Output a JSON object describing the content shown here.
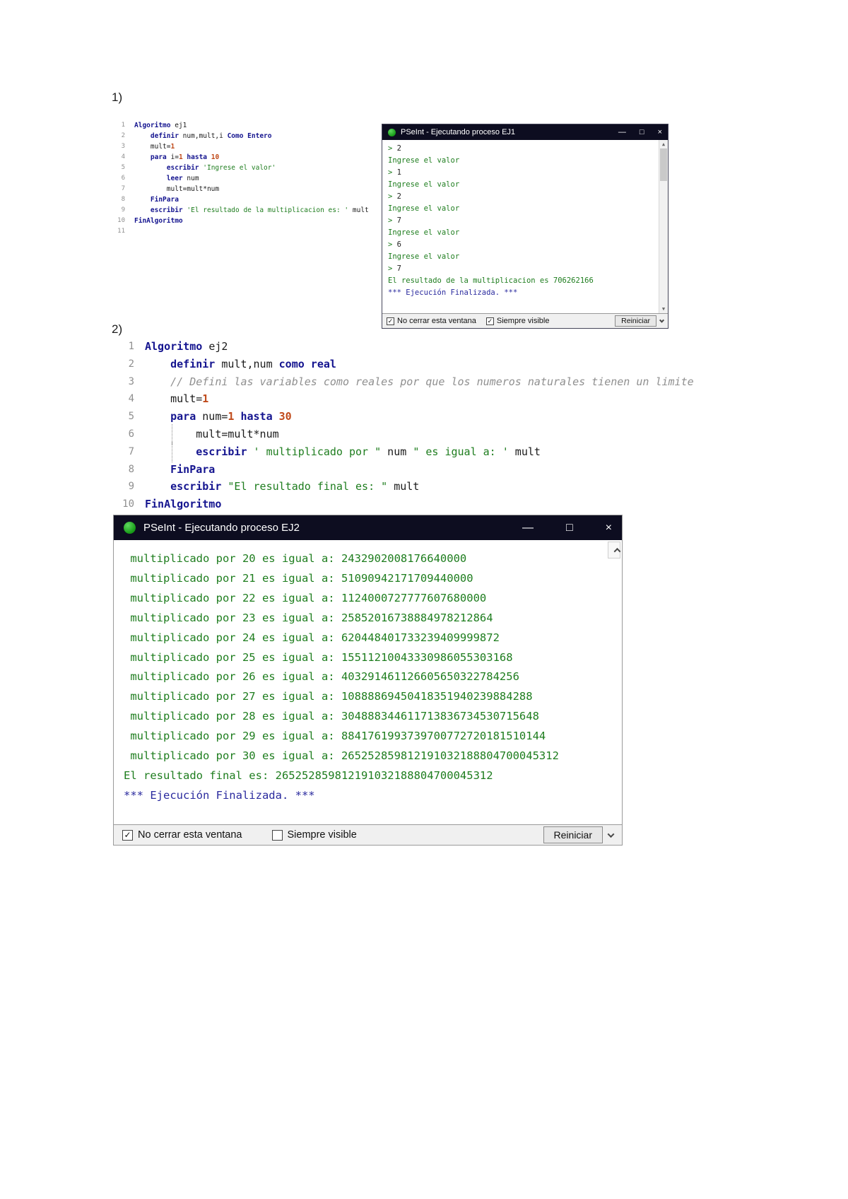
{
  "page": {
    "section1_label": "1)",
    "section2_label": "2)"
  },
  "colors": {
    "title_bar": "#0d0d20",
    "keyword_blue": "#14148f",
    "number_orange": "#c04a1a",
    "string_green": "#1e7d1e",
    "comment_gray": "#8f8f8f",
    "console_green": "#1e7d1e",
    "console_blue": "#2a2a9e",
    "icon_green": "#169a16"
  },
  "editor1": {
    "lines": [
      {
        "n": "1",
        "seg": [
          [
            "Algoritmo ",
            "kw"
          ],
          [
            "ej1",
            "pl"
          ]
        ]
      },
      {
        "n": "2",
        "seg": [
          [
            "    ",
            "pl"
          ],
          [
            "definir ",
            "kw"
          ],
          [
            "num,mult,i ",
            "pl"
          ],
          [
            "Como Entero",
            "kw"
          ]
        ]
      },
      {
        "n": "3",
        "seg": [
          [
            "    mult=",
            "pl"
          ],
          [
            "1",
            "num"
          ]
        ]
      },
      {
        "n": "4",
        "seg": [
          [
            "    ",
            "pl"
          ],
          [
            "para ",
            "kw"
          ],
          [
            "i=",
            "pl"
          ],
          [
            "1",
            "num"
          ],
          [
            " ",
            "pl"
          ],
          [
            "hasta ",
            "kw"
          ],
          [
            "10",
            "num"
          ]
        ]
      },
      {
        "n": "5",
        "seg": [
          [
            "        ",
            "pl"
          ],
          [
            "escribir ",
            "kw"
          ],
          [
            "'Ingrese el valor'",
            "str"
          ]
        ]
      },
      {
        "n": "6",
        "seg": [
          [
            "        ",
            "pl"
          ],
          [
            "leer ",
            "kw"
          ],
          [
            "num",
            "pl"
          ]
        ]
      },
      {
        "n": "7",
        "seg": [
          [
            "        mult=mult*num",
            "pl"
          ]
        ]
      },
      {
        "n": "8",
        "seg": [
          [
            "    ",
            "pl"
          ],
          [
            "FinPara",
            "kw"
          ]
        ]
      },
      {
        "n": "9",
        "seg": [
          [
            "    ",
            "pl"
          ],
          [
            "escribir ",
            "kw"
          ],
          [
            "'El resultado de la multiplicacion es: '",
            "str"
          ],
          [
            " mult",
            "pl"
          ]
        ]
      },
      {
        "n": "10",
        "seg": [
          [
            "FinAlgoritmo",
            "kw"
          ]
        ]
      },
      {
        "n": "11",
        "seg": []
      }
    ]
  },
  "console1": {
    "title": "PSeInt - Ejecutando proceso EJ1",
    "controls": {
      "minimize": "—",
      "maximize": "□",
      "close": "×"
    },
    "lines": [
      {
        "seg": [
          [
            "> ",
            "g"
          ],
          [
            "2",
            "k"
          ]
        ]
      },
      {
        "seg": [
          [
            "Ingrese el valor",
            "g"
          ]
        ]
      },
      {
        "seg": [
          [
            "> ",
            "g"
          ],
          [
            "1",
            "k"
          ]
        ]
      },
      {
        "seg": [
          [
            "Ingrese el valor",
            "g"
          ]
        ]
      },
      {
        "seg": [
          [
            "> ",
            "g"
          ],
          [
            "2",
            "k"
          ]
        ]
      },
      {
        "seg": [
          [
            "Ingrese el valor",
            "g"
          ]
        ]
      },
      {
        "seg": [
          [
            "> ",
            "g"
          ],
          [
            "7",
            "k"
          ]
        ]
      },
      {
        "seg": [
          [
            "Ingrese el valor",
            "g"
          ]
        ]
      },
      {
        "seg": [
          [
            "> ",
            "g"
          ],
          [
            "6",
            "k"
          ]
        ]
      },
      {
        "seg": [
          [
            "Ingrese el valor",
            "g"
          ]
        ]
      },
      {
        "seg": [
          [
            "> ",
            "g"
          ],
          [
            "7",
            "k"
          ]
        ]
      },
      {
        "seg": [
          [
            "El resultado de la multiplicacion es 706262166",
            "g"
          ]
        ]
      },
      {
        "seg": [
          [
            "*** Ejecución Finalizada. ***",
            "b"
          ]
        ]
      }
    ],
    "footer": {
      "no_close_label": "No cerrar esta ventana",
      "no_close_checked": true,
      "always_visible_label": "Siempre visible",
      "always_visible_checked": true,
      "restart_label": "Reiniciar",
      "check_icon": "✓"
    }
  },
  "editor2": {
    "lines": [
      {
        "n": "1",
        "seg": [
          [
            "Algoritmo ",
            "kw"
          ],
          [
            "ej2",
            "pl"
          ]
        ]
      },
      {
        "n": "2",
        "seg": [
          [
            "    ",
            "pl"
          ],
          [
            "definir ",
            "kw"
          ],
          [
            "mult,num ",
            "pl"
          ],
          [
            "como real",
            "kw"
          ]
        ]
      },
      {
        "n": "3",
        "seg": [
          [
            "    ",
            "pl"
          ],
          [
            "// Defini las variables como reales por que los numeros naturales tienen un limite",
            "cmt"
          ]
        ]
      },
      {
        "n": "4",
        "seg": [
          [
            "    mult=",
            "pl"
          ],
          [
            "1",
            "num"
          ]
        ]
      },
      {
        "n": "5",
        "seg": [
          [
            "    ",
            "pl"
          ],
          [
            "para ",
            "kw"
          ],
          [
            "num=",
            "pl"
          ],
          [
            "1",
            "num"
          ],
          [
            " ",
            "pl"
          ],
          [
            "hasta ",
            "kw"
          ],
          [
            "30",
            "num"
          ]
        ]
      },
      {
        "n": "6",
        "guide": true,
        "seg": [
          [
            "        mult=mult*num",
            "pl"
          ]
        ]
      },
      {
        "n": "7",
        "guide": true,
        "seg": [
          [
            "        ",
            "pl"
          ],
          [
            "escribir ",
            "kw"
          ],
          [
            "' multiplicado por \"",
            "str"
          ],
          [
            " num ",
            "pl"
          ],
          [
            "\" es igual a: '",
            "str"
          ],
          [
            " mult",
            "pl"
          ]
        ]
      },
      {
        "n": "8",
        "seg": [
          [
            "    ",
            "pl"
          ],
          [
            "FinPara",
            "kw"
          ]
        ]
      },
      {
        "n": "9",
        "seg": [
          [
            "    ",
            "pl"
          ],
          [
            "escribir ",
            "kw"
          ],
          [
            "\"El resultado final es: \"",
            "str"
          ],
          [
            " mult",
            "pl"
          ]
        ]
      },
      {
        "n": "10",
        "seg": [
          [
            "FinAlgoritmo",
            "kw"
          ]
        ]
      }
    ]
  },
  "console2": {
    "title": "PSeInt - Ejecutando proceso EJ2",
    "controls": {
      "minimize": "—",
      "maximize": "□",
      "close": "×"
    },
    "lines": [
      {
        "seg": [
          [
            " multiplicado por 20 es igual a: 2432902008176640000",
            "g"
          ]
        ]
      },
      {
        "seg": [
          [
            " multiplicado por 21 es igual a: 51090942171709440000",
            "g"
          ]
        ]
      },
      {
        "seg": [
          [
            " multiplicado por 22 es igual a: 1124000727777607680000",
            "g"
          ]
        ]
      },
      {
        "seg": [
          [
            " multiplicado por 23 es igual a: 25852016738884978212864",
            "g"
          ]
        ]
      },
      {
        "seg": [
          [
            " multiplicado por 24 es igual a: 620448401733239409999872",
            "g"
          ]
        ]
      },
      {
        "seg": [
          [
            " multiplicado por 25 es igual a: 15511210043330986055303168",
            "g"
          ]
        ]
      },
      {
        "seg": [
          [
            " multiplicado por 26 es igual a: 403291461126605650322784256",
            "g"
          ]
        ]
      },
      {
        "seg": [
          [
            " multiplicado por 27 es igual a: 10888869450418351940239884288",
            "g"
          ]
        ]
      },
      {
        "seg": [
          [
            " multiplicado por 28 es igual a: 304888344611713836734530715648",
            "g"
          ]
        ]
      },
      {
        "seg": [
          [
            " multiplicado por 29 es igual a: 8841761993739700772720181510144",
            "g"
          ]
        ]
      },
      {
        "seg": [
          [
            " multiplicado por 30 es igual a: 265252859812191032188804700045312",
            "g"
          ]
        ]
      },
      {
        "seg": [
          [
            "El resultado final es: 265252859812191032188804700045312",
            "g"
          ]
        ]
      },
      {
        "seg": [
          [
            "*** Ejecución Finalizada. ***",
            "b"
          ]
        ]
      }
    ],
    "footer": {
      "no_close_label": "No cerrar esta ventana",
      "no_close_checked": true,
      "always_visible_label": "Siempre visible",
      "always_visible_checked": false,
      "restart_label": "Reiniciar",
      "check_icon": "✓"
    }
  }
}
